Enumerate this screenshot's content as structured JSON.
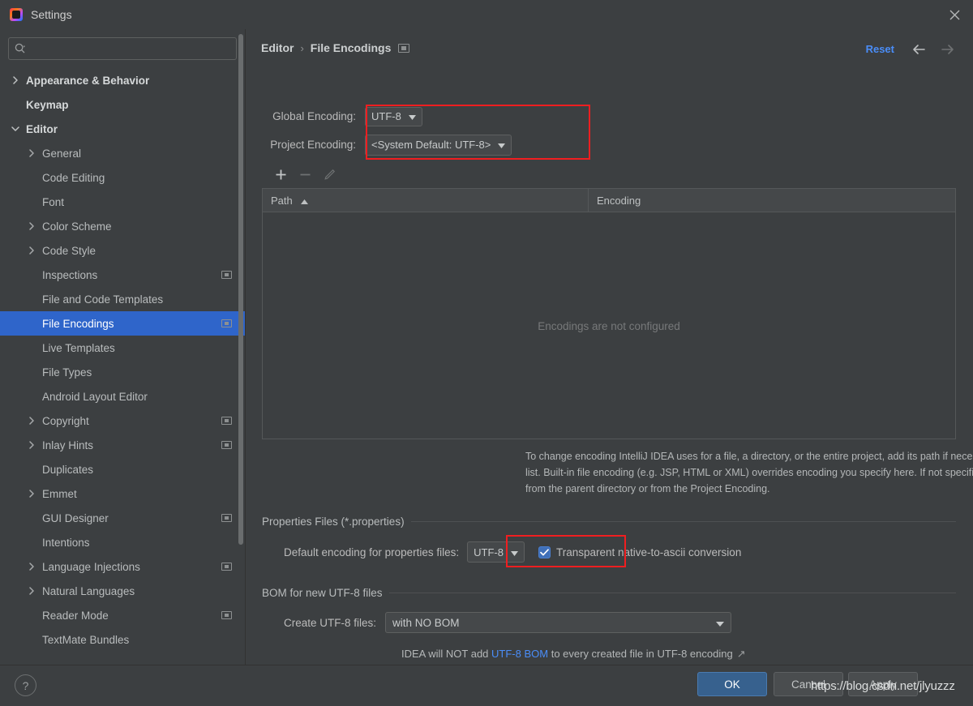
{
  "window": {
    "title": "Settings",
    "app_icon": "intellij-idea-icon",
    "close_icon": "close-icon"
  },
  "sidebar": {
    "search": {
      "placeholder": "",
      "value": "",
      "icon": "search-icon"
    },
    "items": [
      {
        "label": "Appearance & Behavior",
        "level": 0,
        "chevron": "right",
        "bold": true,
        "selected": false,
        "badge": false
      },
      {
        "label": "Keymap",
        "level": 0,
        "chevron": "none",
        "bold": true,
        "selected": false,
        "badge": false
      },
      {
        "label": "Editor",
        "level": 0,
        "chevron": "down",
        "bold": true,
        "selected": false,
        "badge": false
      },
      {
        "label": "General",
        "level": 1,
        "chevron": "right",
        "bold": false,
        "selected": false,
        "badge": false
      },
      {
        "label": "Code Editing",
        "level": 1,
        "chevron": "none",
        "bold": false,
        "selected": false,
        "badge": false
      },
      {
        "label": "Font",
        "level": 1,
        "chevron": "none",
        "bold": false,
        "selected": false,
        "badge": false
      },
      {
        "label": "Color Scheme",
        "level": 1,
        "chevron": "right",
        "bold": false,
        "selected": false,
        "badge": false
      },
      {
        "label": "Code Style",
        "level": 1,
        "chevron": "right",
        "bold": false,
        "selected": false,
        "badge": false
      },
      {
        "label": "Inspections",
        "level": 1,
        "chevron": "none",
        "bold": false,
        "selected": false,
        "badge": true
      },
      {
        "label": "File and Code Templates",
        "level": 1,
        "chevron": "none",
        "bold": false,
        "selected": false,
        "badge": false
      },
      {
        "label": "File Encodings",
        "level": 1,
        "chevron": "none",
        "bold": false,
        "selected": true,
        "badge": true
      },
      {
        "label": "Live Templates",
        "level": 1,
        "chevron": "none",
        "bold": false,
        "selected": false,
        "badge": false
      },
      {
        "label": "File Types",
        "level": 1,
        "chevron": "none",
        "bold": false,
        "selected": false,
        "badge": false
      },
      {
        "label": "Android Layout Editor",
        "level": 1,
        "chevron": "none",
        "bold": false,
        "selected": false,
        "badge": false
      },
      {
        "label": "Copyright",
        "level": 1,
        "chevron": "right",
        "bold": false,
        "selected": false,
        "badge": true
      },
      {
        "label": "Inlay Hints",
        "level": 1,
        "chevron": "right",
        "bold": false,
        "selected": false,
        "badge": true
      },
      {
        "label": "Duplicates",
        "level": 1,
        "chevron": "none",
        "bold": false,
        "selected": false,
        "badge": false
      },
      {
        "label": "Emmet",
        "level": 1,
        "chevron": "right",
        "bold": false,
        "selected": false,
        "badge": false
      },
      {
        "label": "GUI Designer",
        "level": 1,
        "chevron": "none",
        "bold": false,
        "selected": false,
        "badge": true
      },
      {
        "label": "Intentions",
        "level": 1,
        "chevron": "none",
        "bold": false,
        "selected": false,
        "badge": false
      },
      {
        "label": "Language Injections",
        "level": 1,
        "chevron": "right",
        "bold": false,
        "selected": false,
        "badge": true
      },
      {
        "label": "Natural Languages",
        "level": 1,
        "chevron": "right",
        "bold": false,
        "selected": false,
        "badge": false
      },
      {
        "label": "Reader Mode",
        "level": 1,
        "chevron": "none",
        "bold": false,
        "selected": false,
        "badge": true
      },
      {
        "label": "TextMate Bundles",
        "level": 1,
        "chevron": "none",
        "bold": false,
        "selected": false,
        "badge": false
      }
    ]
  },
  "header": {
    "breadcrumb_parent": "Editor",
    "breadcrumb_separator": "›",
    "breadcrumb_current": "File Encodings",
    "badge_icon": "module-badge-icon",
    "reset_label": "Reset",
    "back_icon": "arrow-left-icon",
    "forward_icon": "arrow-right-icon"
  },
  "encodings": {
    "global_label": "Global Encoding:",
    "global_value": "UTF-8",
    "project_label": "Project Encoding:",
    "project_value": "<System Default: UTF-8>",
    "caret_icon": "chevron-down-icon"
  },
  "table": {
    "toolbar": {
      "add_icon": "plus-icon",
      "remove_icon": "minus-icon",
      "edit_icon": "pencil-icon"
    },
    "columns": [
      "Path",
      "Encoding"
    ],
    "sort_indicator": "▲",
    "rows": [],
    "empty_text": "Encodings are not configured"
  },
  "description": "To change encoding IntelliJ IDEA uses for a file, a directory, or the entire project, add its path if necessary and then select encoding from the encoding list. Built-in file encoding (e.g. JSP, HTML or XML) overrides encoding you specify here. If not specified, files and directories inherit encoding settings from the parent directory or from the Project Encoding.",
  "properties_section": {
    "title": "Properties Files (*.properties)",
    "default_encoding_label": "Default encoding for properties files:",
    "default_encoding_value": "UTF-8",
    "checkbox_checked": true,
    "checkbox_mark": "✓",
    "checkbox_label": "Transparent native-to-ascii conversion"
  },
  "bom_section": {
    "title": "BOM for new UTF-8 files",
    "create_label": "Create UTF-8 files:",
    "create_value": "with NO BOM",
    "note_prefix": "IDEA will NOT add ",
    "note_link": "UTF-8 BOM",
    "note_suffix": " to every created file in UTF-8 encoding",
    "external_link_icon": "↗"
  },
  "footer": {
    "help_label": "?",
    "ok_label": "OK",
    "cancel_label": "Cancel",
    "apply_label": "Apply"
  },
  "watermark": "https://blog.csdn.net/jlyuzzz",
  "colors": {
    "background": "#3c3f41",
    "selection": "#2f65ca",
    "accent_link": "#4a8df8",
    "highlight_box": "#f01e20",
    "ok_button": "#37618e"
  }
}
